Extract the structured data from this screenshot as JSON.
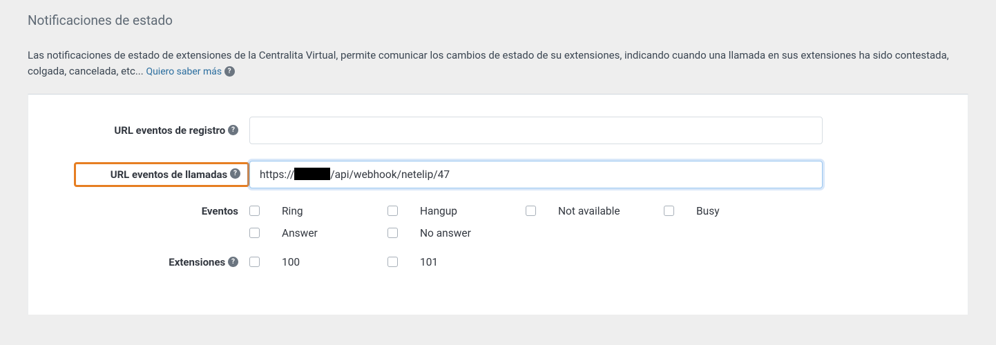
{
  "section": {
    "title": "Notificaciones de estado",
    "description_prefix": "Las notificaciones de estado de extensiones de la Centralita Virtual, permite comunicar los cambios de estado de su extensiones, indicando cuando una llamada en sus extensiones ha sido contestada, colgada, cancelada, etc... ",
    "learn_more": "Quiero saber más"
  },
  "form": {
    "url_registro": {
      "label": "URL eventos de registro",
      "value": ""
    },
    "url_llamadas": {
      "label": "URL eventos de llamadas",
      "value_prefix": "https://",
      "value_suffix": "/api/webhook/netelip/47"
    },
    "eventos": {
      "label": "Eventos",
      "items": [
        {
          "label": "Ring"
        },
        {
          "label": "Hangup"
        },
        {
          "label": "Not available"
        },
        {
          "label": "Busy"
        },
        {
          "label": "Answer"
        },
        {
          "label": "No answer"
        }
      ]
    },
    "extensiones": {
      "label": "Extensiones",
      "items": [
        {
          "label": "100"
        },
        {
          "label": "101"
        }
      ]
    }
  }
}
